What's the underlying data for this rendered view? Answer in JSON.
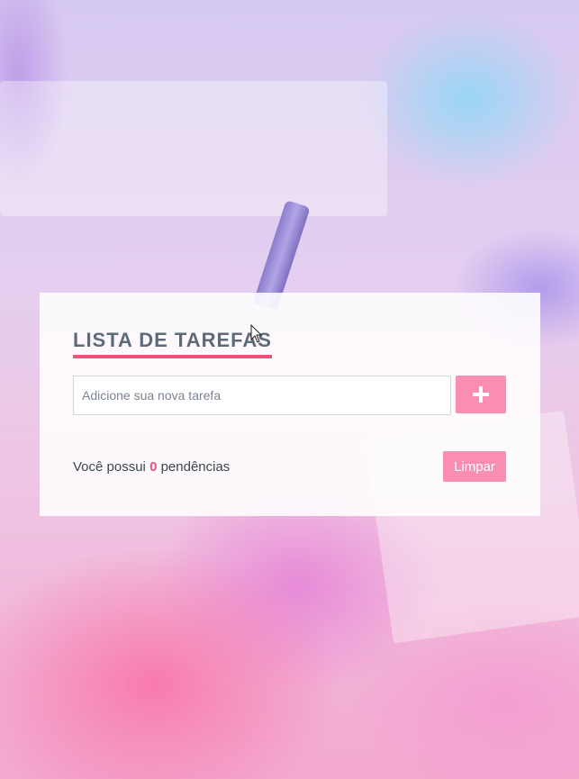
{
  "todo": {
    "title": "LISTA DE TAREFAS",
    "input": {
      "placeholder": "Adicione sua nova tarefa",
      "value": ""
    },
    "add_button_icon": "plus-icon",
    "status": {
      "prefix": "Você possui ",
      "count": "0",
      "suffix": " pendências"
    },
    "clear_label": "Limpar"
  },
  "colors": {
    "accent": "#f0517e",
    "button": "#f98eb0",
    "title": "#5d6a78"
  }
}
